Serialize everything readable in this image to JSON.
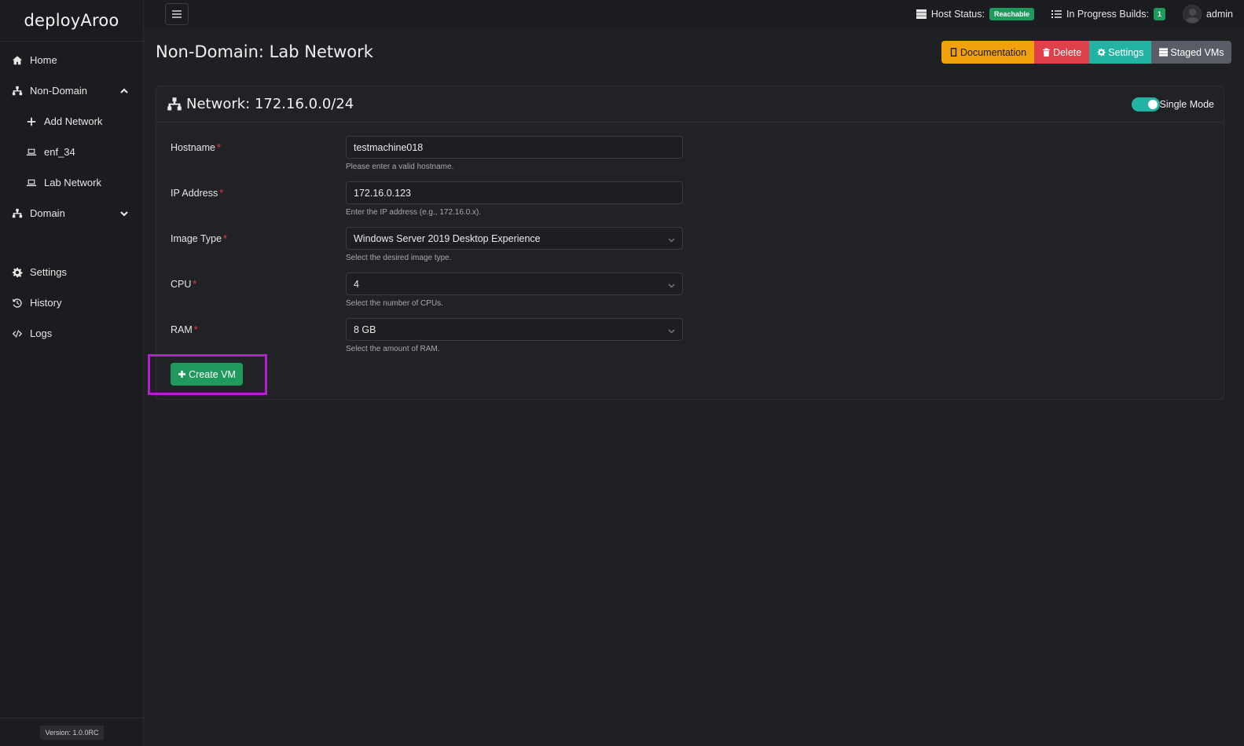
{
  "app": {
    "brand": "deployAroo",
    "version": "Version: 1.0.0RC"
  },
  "sidebar": {
    "items": [
      {
        "label": "Home",
        "icon": "home-icon"
      },
      {
        "label": "Non-Domain",
        "icon": "sitemap-icon",
        "expanded": true
      },
      {
        "label": "Add Network",
        "icon": "plus-icon"
      },
      {
        "label": "enf_34",
        "icon": "laptop-icon"
      },
      {
        "label": "Lab Network",
        "icon": "laptop-icon"
      },
      {
        "label": "Domain",
        "icon": "sitemap-icon",
        "expanded": false
      },
      {
        "label": "Settings",
        "icon": "gear-icon"
      },
      {
        "label": "History",
        "icon": "history-icon"
      },
      {
        "label": "Logs",
        "icon": "code-icon"
      }
    ]
  },
  "topbar": {
    "host_status_label": "Host Status:",
    "host_status_value": "Reachable",
    "builds_label": "In Progress Builds:",
    "builds_count": "1",
    "user": "admin"
  },
  "page": {
    "title": "Non-Domain: Lab Network",
    "actions": {
      "documentation": "Documentation",
      "delete": "Delete",
      "settings": "Settings",
      "staged": "Staged VMs"
    }
  },
  "card": {
    "title": "Network: 172.16.0.0/24",
    "single_mode_label": "Single Mode",
    "single_mode_on": true
  },
  "form": {
    "hostname": {
      "label": "Hostname",
      "value": "testmachine018",
      "help": "Please enter a valid hostname."
    },
    "ip": {
      "label": "IP Address",
      "value": "172.16.0.123",
      "help": "Enter the IP address (e.g., 172.16.0.x)."
    },
    "image": {
      "label": "Image Type",
      "value": "Windows Server 2019 Desktop Experience",
      "help": "Select the desired image type."
    },
    "cpu": {
      "label": "CPU",
      "value": "4",
      "help": "Select the number of CPUs."
    },
    "ram": {
      "label": "RAM",
      "value": "8 GB",
      "help": "Select the amount of RAM."
    },
    "required_mark": "*",
    "submit": "Create VM"
  },
  "colors": {
    "success": "#1e9a5c",
    "warning": "#f0a10c",
    "danger": "#e0404a",
    "info": "#22b3a3",
    "highlight": "#b41ed3"
  }
}
